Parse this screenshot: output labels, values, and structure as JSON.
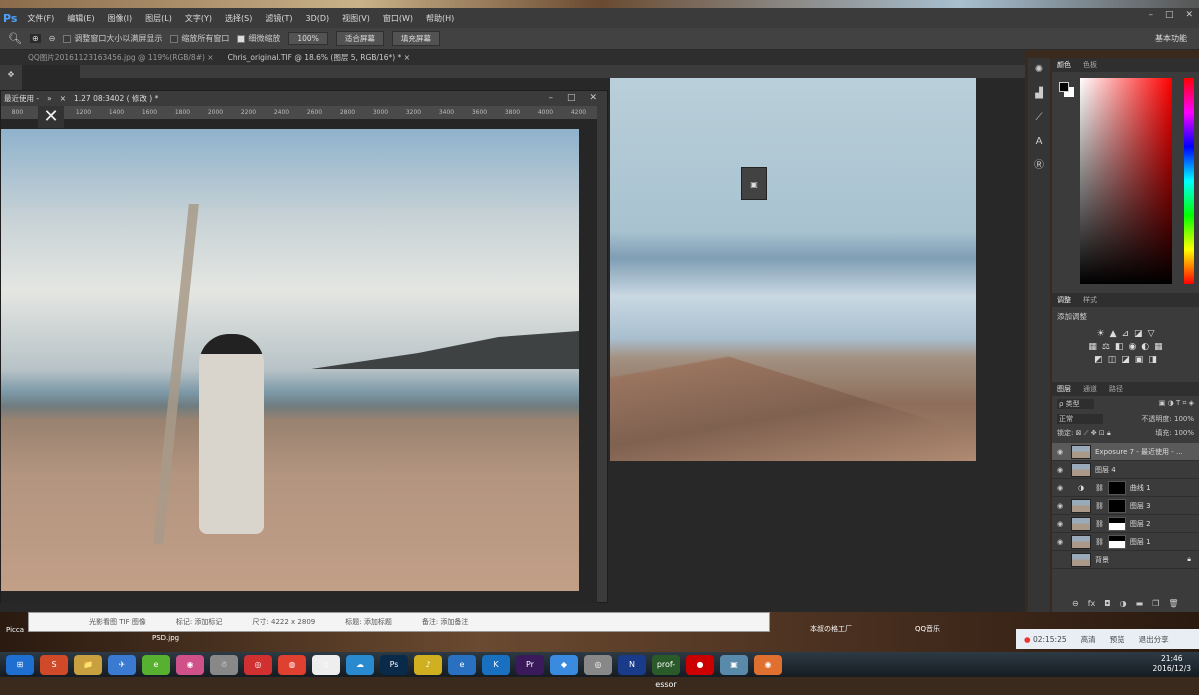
{
  "app": {
    "logo": "Ps",
    "workspace": "基本功能"
  },
  "menu": [
    "文件(F)",
    "编辑(E)",
    "图像(I)",
    "图层(L)",
    "文字(Y)",
    "选择(S)",
    "滤镜(T)",
    "3D(D)",
    "视图(V)",
    "窗口(W)",
    "帮助(H)"
  ],
  "window_controls": [
    "–",
    "□",
    "✕"
  ],
  "options": {
    "resize_windows": "调整窗口大小以满屏显示",
    "zoom_all": "缩放所有窗口",
    "scrubby_zoom": "细微缩放",
    "zoom_100": "100%",
    "fit_screen": "适合屏幕",
    "fill_screen": "填充屏幕",
    "scrubby_checked": true
  },
  "tabs": [
    {
      "label": "QQ图片20161123163456.jpg @ 119%(RGB/8#) ×"
    },
    {
      "label": "Chris_original.TIF @ 18.6% (图层 5, RGB/16*) * ×"
    }
  ],
  "float_window": {
    "panel_label": "最近使用 -",
    "title": "1.27 08:3402 ( 修改 ) *",
    "ruler": [
      "800",
      "1000",
      "1200",
      "1400",
      "1600",
      "1800",
      "2000",
      "2200",
      "2400",
      "2600",
      "2800",
      "3000",
      "3200",
      "3400",
      "3600",
      "3800",
      "4000",
      "4200"
    ]
  },
  "color_panel": {
    "tabs": [
      "颜色",
      "色板"
    ],
    "foreground": "#000000",
    "background": "#ffffff"
  },
  "adjustments": {
    "tabs": [
      "调整",
      "样式"
    ],
    "heading": "添加调整",
    "rows": [
      [
        "☀",
        "▲",
        "⊿",
        "◪",
        "▽"
      ],
      [
        "▦",
        "⚖",
        "◧",
        "◉",
        "◐",
        "▦"
      ],
      [
        "◩",
        "◫",
        "◪",
        "▣",
        "◨"
      ]
    ]
  },
  "layers": {
    "tabs": [
      "图层",
      "通道",
      "路径"
    ],
    "filter": "ρ 类型",
    "blend": "正常",
    "opacity_label": "不透明度:",
    "opacity": "100%",
    "lock_label": "锁定:",
    "fill_label": "填充:",
    "fill": "100%",
    "items": [
      {
        "name": "Exposure 7 - 最近使用 - ...",
        "visible": true,
        "selected": true,
        "mask": ""
      },
      {
        "name": "图层 4",
        "visible": true,
        "mask": ""
      },
      {
        "name": "曲线 1",
        "visible": true,
        "mask": "black",
        "adjustment": true
      },
      {
        "name": "图层 3",
        "visible": true,
        "mask": "black"
      },
      {
        "name": "图层 2",
        "visible": true,
        "mask": "white"
      },
      {
        "name": "图层 1",
        "visible": true,
        "mask": "white"
      },
      {
        "name": "背景",
        "visible": false,
        "mask": "",
        "locked": true
      }
    ],
    "footer": [
      "⊖",
      "fx",
      "◘",
      "◑",
      "▬",
      "❐",
      "🗑"
    ]
  },
  "file_info": {
    "type": "光影看图 TIF 图像",
    "tag": "标记: 添加标记",
    "size": "尺寸: 4222 x 2809",
    "title": "标题: 添加标题",
    "note": "备注: 添加备注"
  },
  "desktop": {
    "icons": [
      "Picca",
      "PSD.jpg",
      "本叔の格工厂",
      "QQ音乐"
    ]
  },
  "recording": {
    "time": "02:15:25",
    "buttons": [
      "高清",
      "预览",
      "退出分享"
    ]
  },
  "taskbar": {
    "apps": [
      "⊞",
      "S",
      "📁",
      "✈",
      "e",
      "◉",
      "☃",
      "◎",
      "◍",
      "▯",
      "☁",
      "Ps",
      "♪",
      "e",
      "K",
      "Pr",
      "◆",
      "◎",
      "N",
      "prof-essor",
      "●",
      "▣",
      "◉"
    ],
    "time": "21:46",
    "date": "2016/12/3"
  }
}
